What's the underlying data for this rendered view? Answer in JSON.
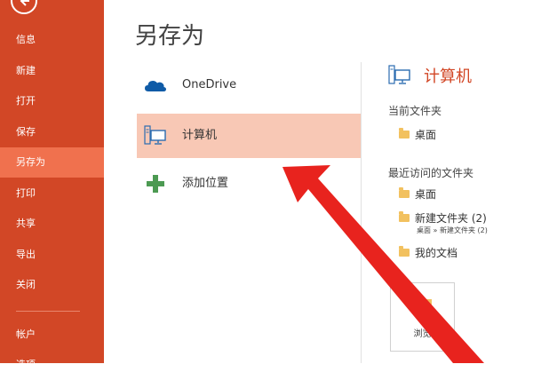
{
  "sidebar": {
    "items": [
      {
        "label": "信息"
      },
      {
        "label": "新建"
      },
      {
        "label": "打开"
      },
      {
        "label": "保存"
      },
      {
        "label": "另存为"
      },
      {
        "label": "打印"
      },
      {
        "label": "共享"
      },
      {
        "label": "导出"
      },
      {
        "label": "关闭"
      },
      {
        "label": "帐户"
      },
      {
        "label": "选项"
      }
    ],
    "active_index": 4
  },
  "main": {
    "title": "另存为",
    "locations": [
      {
        "label": "OneDrive",
        "icon": "onedrive-cloud-icon"
      },
      {
        "label": "计算机",
        "icon": "computer-icon"
      },
      {
        "label": "添加位置",
        "icon": "plus-icon"
      }
    ],
    "selected_location_index": 1
  },
  "right_panel": {
    "heading": "计算机",
    "current_folder_label": "当前文件夹",
    "current_folder": {
      "name": "桌面"
    },
    "recent_label": "最近访问的文件夹",
    "recent_folders": [
      {
        "name": "桌面",
        "path": ""
      },
      {
        "name": "新建文件夹 (2)",
        "path": "桌面 » 新建文件夹 (2)"
      },
      {
        "name": "我的文档",
        "path": ""
      }
    ],
    "browse_label": "浏览"
  },
  "colors": {
    "sidebar_bg": "#d24726",
    "sidebar_active": "#f0714e",
    "selected_location_bg": "#f8c8b5",
    "heading_accent": "#d24726",
    "annotation_arrow": "#e8231e"
  }
}
